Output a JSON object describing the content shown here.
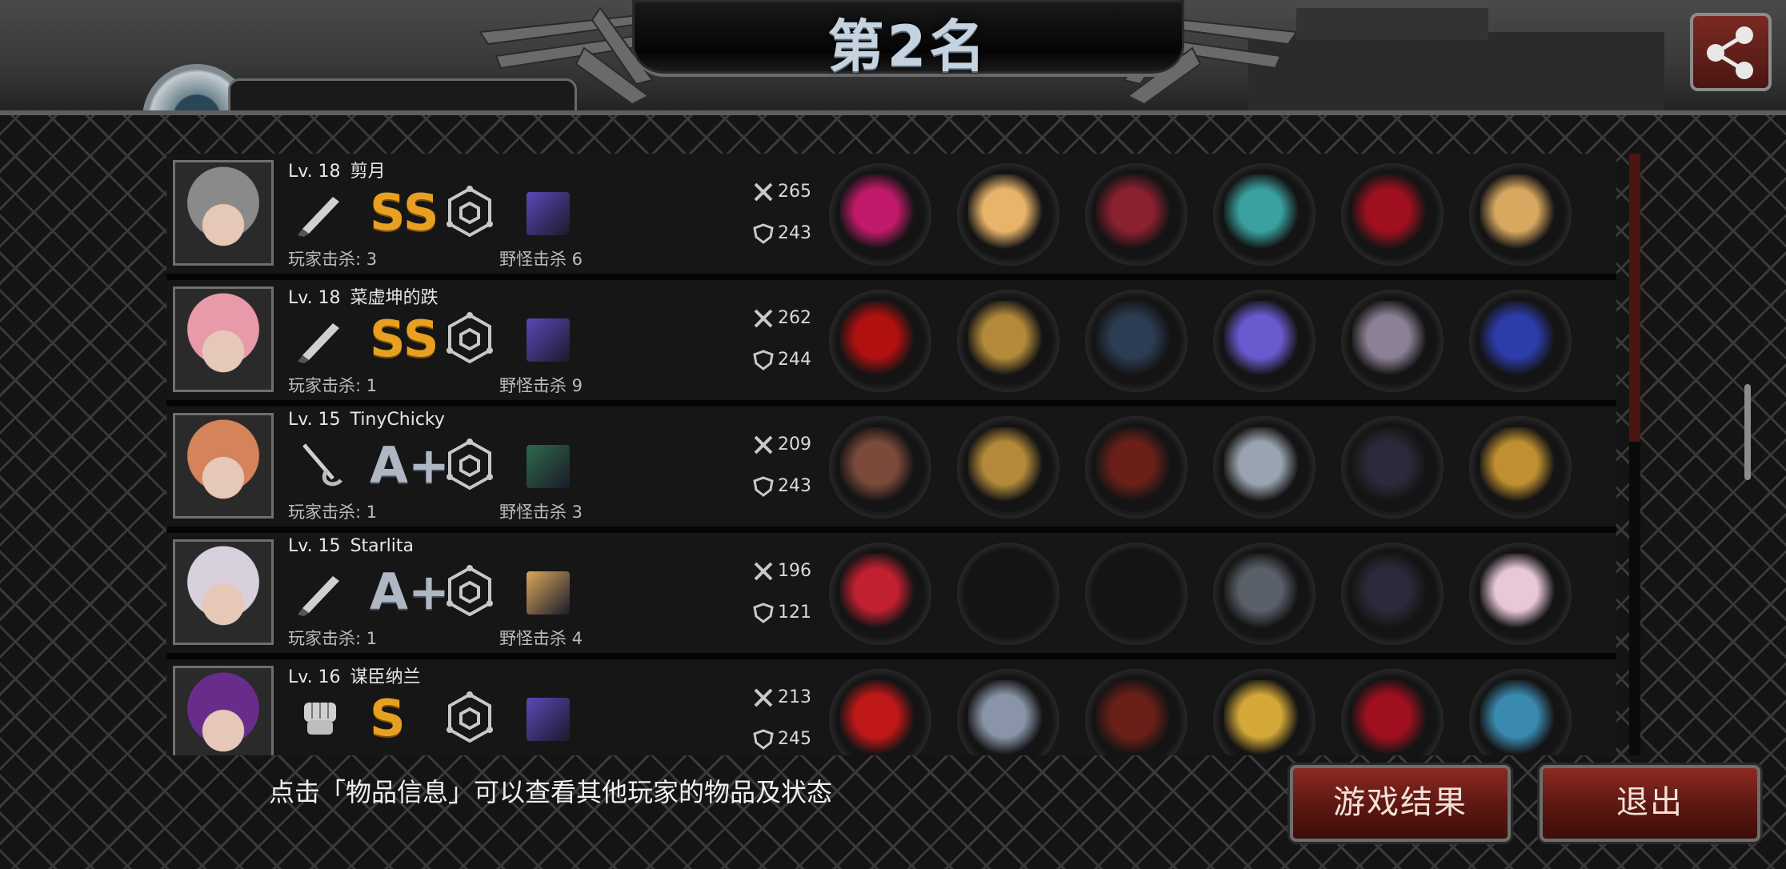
{
  "header": {
    "rank_title": "第2名",
    "share_icon": "share-icon"
  },
  "players": [
    {
      "level": "Lv. 18",
      "name": "剪月",
      "grade": "SS",
      "grade_color": "#e7a021",
      "weapon_icon": "knife-icon",
      "player_kills_label": "玩家击杀: 3",
      "monster_kills_label": "野怪击杀 6",
      "attack": "265",
      "defense": "243",
      "avatar_hair": "#8a8a8a",
      "cube_color": "#5b48b8",
      "slots": [
        "#c21a6a",
        "#e8b36a",
        "#8a2030",
        "#3aa0a0",
        "#a01020",
        "#d9a860"
      ]
    },
    {
      "level": "Lv. 18",
      "name": "菜虚坤的跌",
      "grade": "SS",
      "grade_color": "#e7a021",
      "weapon_icon": "knife-icon",
      "player_kills_label": "玩家击杀: 1",
      "monster_kills_label": "野怪击杀 9",
      "attack": "262",
      "defense": "244",
      "avatar_hair": "#e89aa8",
      "cube_color": "#5b48b8",
      "slots": [
        "#b01010",
        "#b38a3a",
        "#2c3c52",
        "#6a5ad0",
        "#8c8094",
        "#2c3ca8"
      ]
    },
    {
      "level": "Lv. 15",
      "name": "TinyChicky",
      "grade": "A+",
      "grade_color": "#aeb7c3",
      "weapon_icon": "rapier-icon",
      "player_kills_label": "玩家击杀: 1",
      "monster_kills_label": "野怪击杀 3",
      "attack": "209",
      "defense": "243",
      "avatar_hair": "#d4835a",
      "cube_color": "#2f6a4a",
      "slots": [
        "#7a4a3a",
        "#b38a3a",
        "#6a2018",
        "#9aa4b0",
        "#2a2a3a",
        "#c09030"
      ]
    },
    {
      "level": "Lv. 15",
      "name": "Starlita",
      "grade": "A+",
      "grade_color": "#aeb7c3",
      "weapon_icon": "knife-icon",
      "player_kills_label": "玩家击杀: 1",
      "monster_kills_label": "野怪击杀 4",
      "attack": "196",
      "defense": "121",
      "avatar_hair": "#d8d0dc",
      "cube_color": "#d9a85a",
      "slots": [
        "#c02030",
        "",
        "",
        "#5a606a",
        "#2a2a3a",
        "#e8c8d8"
      ]
    },
    {
      "level": "Lv. 16",
      "name": "谋臣纳兰",
      "grade": "S",
      "grade_color": "#e7a021",
      "weapon_icon": "fist-icon",
      "player_kills_label": "",
      "monster_kills_label": "",
      "attack": "213",
      "defense": "245",
      "avatar_hair": "#6a2c8a",
      "cube_color": "#5b48b8",
      "slots": [
        "#c01818",
        "#8a94a8",
        "#6a2018",
        "#d4a838",
        "#a01020",
        "#3a8ab0"
      ]
    }
  ],
  "footer": {
    "hint": "点击「物品信息」可以查看其他玩家的物品及状态",
    "result_button": "游戏结果",
    "exit_button": "退出"
  }
}
